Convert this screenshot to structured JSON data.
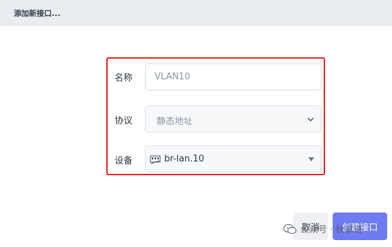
{
  "header": {
    "title": "添加新接口..."
  },
  "form": {
    "name": {
      "label": "名称",
      "placeholder": "VLAN10"
    },
    "protocol": {
      "label": "协议",
      "selected": "静态地址"
    },
    "device": {
      "label": "设备",
      "selected": "br-lan.10"
    }
  },
  "buttons": {
    "cancel": "取消",
    "create": "创建接口"
  },
  "watermark": {
    "text": "公众号 · 秋拿哥"
  },
  "colors": {
    "highlight": "#e5211f",
    "primary": "#6e7cf0",
    "header_bg": "#e9edf1"
  },
  "icons": {
    "protocol_dropdown": "chevron-down-icon",
    "device_dropdown": "triangle-down-icon",
    "device_port": "ethernet-port-icon",
    "watermark": "wechat-icon"
  }
}
